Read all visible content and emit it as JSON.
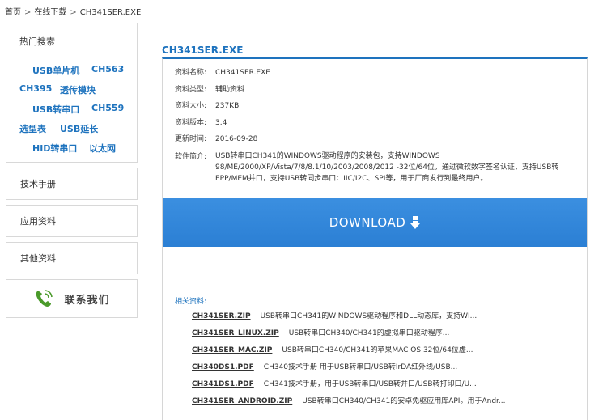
{
  "breadcrumb": {
    "home": "首页",
    "sep1": ">",
    "section": "在线下载",
    "sep2": ">",
    "current": "CH341SER.EXE"
  },
  "sidebar": {
    "hot_title": "热门搜索",
    "hot_links": [
      "USB单片机",
      "CH563",
      "CH395",
      "透传模块",
      "USB转串口",
      "CH559",
      "选型表",
      "USB延长",
      "HID转串口",
      "以太网"
    ],
    "items": [
      "技术手册",
      "应用资料",
      "其他资料"
    ],
    "contact_label": "联系我们"
  },
  "main": {
    "title": "CH341SER.EXE",
    "info": [
      {
        "key": "资料名称:",
        "value": "CH341SER.EXE"
      },
      {
        "key": "资料类型:",
        "value": "辅助资料"
      },
      {
        "key": "资料大小:",
        "value": "237KB"
      },
      {
        "key": "资料版本:",
        "value": "3.4"
      },
      {
        "key": "更新时间:",
        "value": "2016-09-28"
      }
    ],
    "desc_key": "软件简介:",
    "desc_lines": [
      "USB转串口CH341的WINDOWS驱动程序的安装包，支持WINDOWS",
      "98/ME/2000/XP/Vista/7/8/8.1/10/2003/2008/2012 -32位/64位，通过微软数字签名认证，支持USB转",
      "EPP/MEM并口，支持USB转同步串口：IIC/I2C、SPI等，用于厂商发行到最终用户。"
    ],
    "download_label": "DOWNLOAD",
    "related_title": "相关资料:",
    "related": [
      {
        "name": "CH341SER.ZIP",
        "desc": "USB转串口CH341的WINDOWS驱动程序和DLL动态库，支持WI..."
      },
      {
        "name": "CH341SER_LINUX.ZIP",
        "desc": "USB转串口CH340/CH341的虚拟串口驱动程序..."
      },
      {
        "name": "CH341SER_MAC.ZIP",
        "desc": "USB转串口CH340/CH341的苹果MAC OS 32位/64位虚..."
      },
      {
        "name": "CH340DS1.PDF",
        "desc": "CH340技术手册 用于USB转串口/USB转IrDA红外线/USB..."
      },
      {
        "name": "CH341DS1.PDF",
        "desc": "CH341技术手册，用于USB转串口/USB转并口/USB转打印口/U..."
      },
      {
        "name": "CH341SER_ANDROID.ZIP",
        "desc": "USB转串口CH340/CH341的安卓免驱应用库API。用于Andr..."
      }
    ]
  }
}
